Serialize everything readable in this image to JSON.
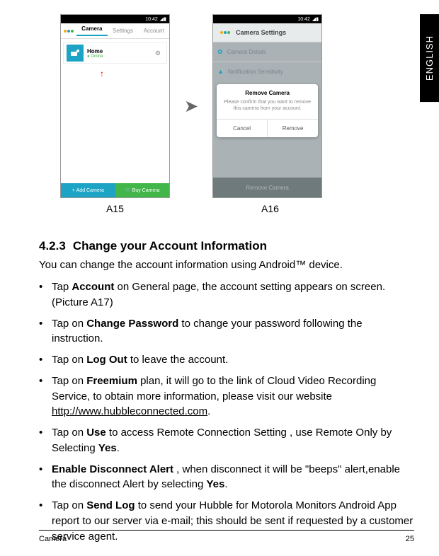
{
  "language_tab": "ENGLISH",
  "phone1": {
    "time": "10:42",
    "tabs": {
      "camera": "Camera",
      "settings": "Settings",
      "account": "Account"
    },
    "home": {
      "label": "Home",
      "status": "Online"
    },
    "add_camera": "Add Camera",
    "buy_camera": "Buy Camera"
  },
  "phone2": {
    "time": "10:42",
    "header": "Camera Settings",
    "item_details": "Camera Details",
    "item_notif": "Notification Sensitivity",
    "modal": {
      "title": "Remove Camera",
      "text": "Please confirm that you want to remove this camera from your account.",
      "cancel": "Cancel",
      "remove": "Remove"
    },
    "bottom": "Remove Camera"
  },
  "captions": {
    "a15": "A15",
    "a16": "A16"
  },
  "section": {
    "num": "4.2.3",
    "title": "Change your Account Information",
    "intro": "You can change the account information using Android™ device.",
    "items": [
      {
        "pre": "Tap ",
        "b1": "Account",
        "post": " on General page, the account setting appears on screen. (Picture A17)"
      },
      {
        "pre": "Tap on ",
        "b1": "Change Password",
        "post": " to change your password following the instruction."
      },
      {
        "pre": "Tap on ",
        "b1": "Log Out",
        "post": " to leave the account."
      },
      {
        "pre": "Tap on ",
        "b1": "Freemium",
        "post": " plan, it will go to the link of Cloud Video Recording Service, to obtain more information, please visit our website ",
        "link": "http://www.hubbleconnected.com",
        "tail": "."
      },
      {
        "pre": "Tap on ",
        "b1": "Use",
        "post": " to access Remote Connection Setting , use Remote Only by Selecting ",
        "b2": "Yes",
        "tail": "."
      },
      {
        "b1": "Enable Disconnect Alert",
        "post": " , when disconnect it will be \"beeps\" alert,enable the disconnect Alert by selecting ",
        "b2": "Yes",
        "tail": "."
      },
      {
        "pre": "Tap on ",
        "b1": "Send Log",
        "post": " to send your Hubble for Motorola Monitors Android App report to our server via e-mail; this should be sent if requested by a customer service agent."
      }
    ]
  },
  "footer": {
    "left": "Camera",
    "right": "25"
  }
}
